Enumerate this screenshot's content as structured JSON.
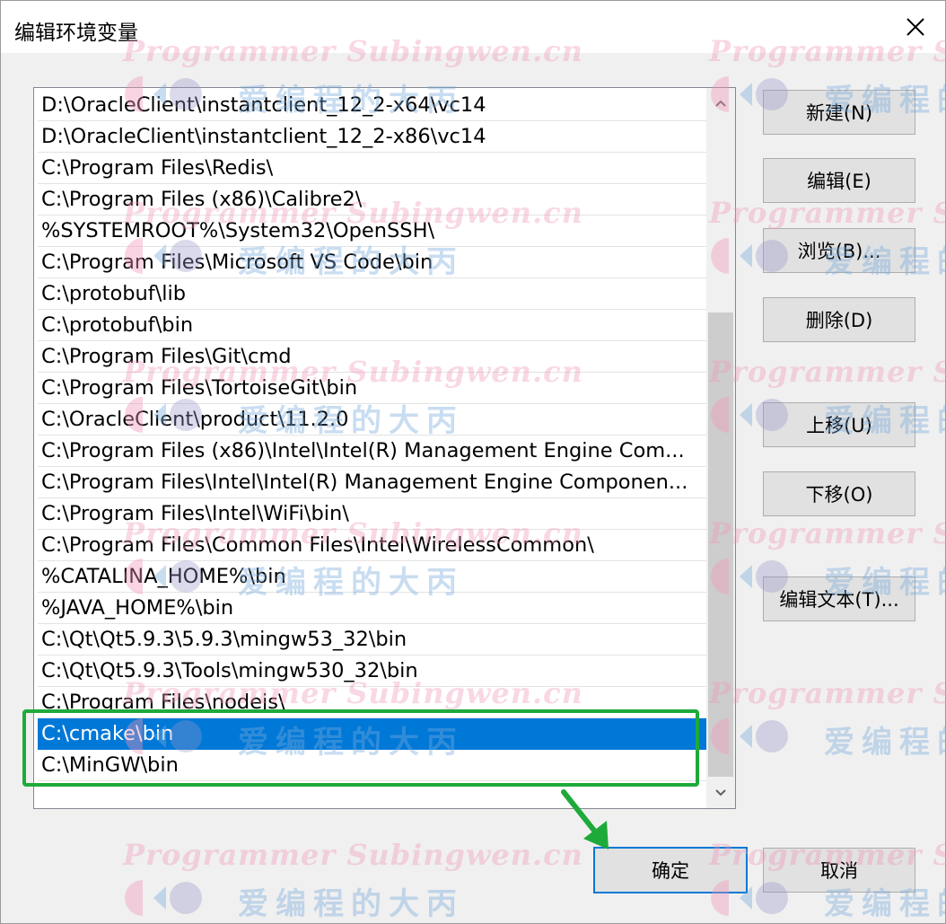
{
  "dialog": {
    "title": "编辑环境变量",
    "close_label": "✕"
  },
  "path_list": {
    "items": [
      {
        "text": "D:\\OracleClient\\instantclient_12_2-x64\\vc14",
        "selected": false
      },
      {
        "text": "D:\\OracleClient\\instantclient_12_2-x86\\vc14",
        "selected": false
      },
      {
        "text": "C:\\Program Files\\Redis\\",
        "selected": false
      },
      {
        "text": "C:\\Program Files (x86)\\Calibre2\\",
        "selected": false
      },
      {
        "text": "%SYSTEMROOT%\\System32\\OpenSSH\\",
        "selected": false
      },
      {
        "text": "C:\\Program Files\\Microsoft VS Code\\bin",
        "selected": false
      },
      {
        "text": "C:\\protobuf\\lib",
        "selected": false
      },
      {
        "text": "C:\\protobuf\\bin",
        "selected": false
      },
      {
        "text": "C:\\Program Files\\Git\\cmd",
        "selected": false
      },
      {
        "text": "C:\\Program Files\\TortoiseGit\\bin",
        "selected": false
      },
      {
        "text": "C:\\OracleClient\\product\\11.2.0",
        "selected": false
      },
      {
        "text": "C:\\Program Files (x86)\\Intel\\Intel(R) Management Engine Com...",
        "selected": false
      },
      {
        "text": "C:\\Program Files\\Intel\\Intel(R) Management Engine Componen...",
        "selected": false
      },
      {
        "text": "C:\\Program Files\\Intel\\WiFi\\bin\\",
        "selected": false
      },
      {
        "text": "C:\\Program Files\\Common Files\\Intel\\WirelessCommon\\",
        "selected": false
      },
      {
        "text": "%CATALINA_HOME%\\bin",
        "selected": false
      },
      {
        "text": "%JAVA_HOME%\\bin",
        "selected": false
      },
      {
        "text": "C:\\Qt\\Qt5.9.3\\5.9.3\\mingw53_32\\bin",
        "selected": false
      },
      {
        "text": "C:\\Qt\\Qt5.9.3\\Tools\\mingw530_32\\bin",
        "selected": false
      },
      {
        "text": "C:\\Program Files\\nodejs\\",
        "selected": false
      },
      {
        "text": "C:\\cmake\\bin",
        "selected": true
      },
      {
        "text": "C:\\MinGW\\bin",
        "selected": false
      }
    ]
  },
  "buttons": {
    "new": "新建(N)",
    "edit": "编辑(E)",
    "browse": "浏览(B)...",
    "delete": "删除(D)",
    "move_up": "上移(U)",
    "move_down": "下移(O)",
    "edit_text": "编辑文本(T)...",
    "ok": "确定",
    "cancel": "取消"
  },
  "watermark": {
    "en": "Programmer Subingwen.cn",
    "cn": "爱编程的大丙"
  },
  "colors": {
    "selection": "#0078d7",
    "highlight_box": "#1eaa3a",
    "arrow": "#1eaa3a"
  }
}
